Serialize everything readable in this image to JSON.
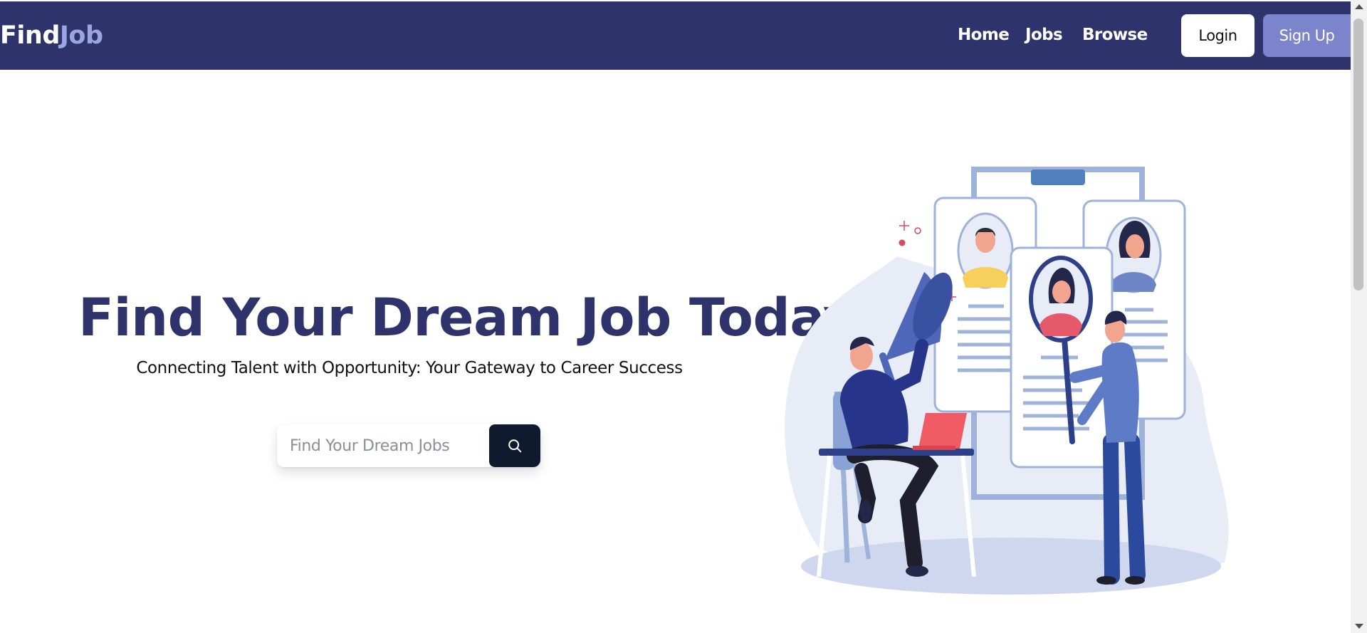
{
  "brand": {
    "part1": "Find",
    "part2": "Job"
  },
  "nav": {
    "links": [
      {
        "label": "Home"
      },
      {
        "label": "Jobs"
      },
      {
        "label": "Browse"
      }
    ],
    "login_label": "Login",
    "signup_label": "Sign Up"
  },
  "hero": {
    "title": "Find Your Dream Job Today",
    "subtitle": "Connecting Talent with Opportunity: Your Gateway to Career Success"
  },
  "search": {
    "placeholder": "Find Your Dream Jobs",
    "value": "",
    "button_icon": "search-icon"
  },
  "colors": {
    "navbar": "#2e336b",
    "brand_accent": "#9aa6e3",
    "signup_button": "#7c84cc",
    "title": "#2e336b",
    "search_button": "#101a2e"
  },
  "illustration": {
    "icon": "recruitment-illustration"
  }
}
